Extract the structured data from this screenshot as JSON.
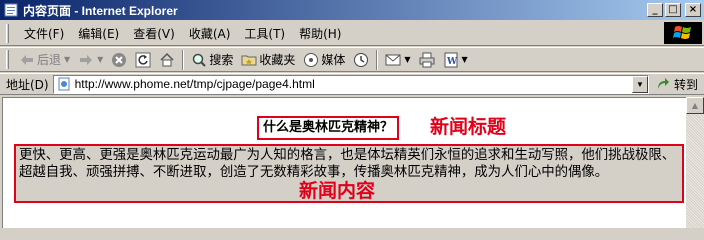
{
  "window": {
    "title": "内容页面 - Internet Explorer",
    "minimize_glyph": "_",
    "maximize_glyph": "□",
    "close_glyph": "×"
  },
  "menu": {
    "items": [
      {
        "label": "文件(F)"
      },
      {
        "label": "编辑(E)"
      },
      {
        "label": "查看(V)"
      },
      {
        "label": "收藏(A)"
      },
      {
        "label": "工具(T)"
      },
      {
        "label": "帮助(H)"
      }
    ]
  },
  "toolbar": {
    "back_label": "后退",
    "search_label": "搜索",
    "favorites_label": "收藏夹",
    "media_label": "媒体"
  },
  "address": {
    "label": "地址(D)",
    "url": "http://www.phome.net/tmp/cjpage/page4.html",
    "go_label": "转到"
  },
  "page": {
    "news_title": "什么是奥林匹克精神？",
    "news_body": "更快、更高、更强是奥林匹克运动最广为人知的格言，也是体坛精英们永恒的追求和生动写照，他们挑战极限、超越自我、顽强拼搏、不断进取，创造了无数精彩故事，传播奥林匹克精神，成为人们心中的偶像。",
    "title_annotation": "新闻标题",
    "body_annotation": "新闻内容"
  },
  "colors": {
    "annotation_red": "#e0001a",
    "titlebar_start": "#0a246a",
    "titlebar_end": "#a6caf0"
  }
}
